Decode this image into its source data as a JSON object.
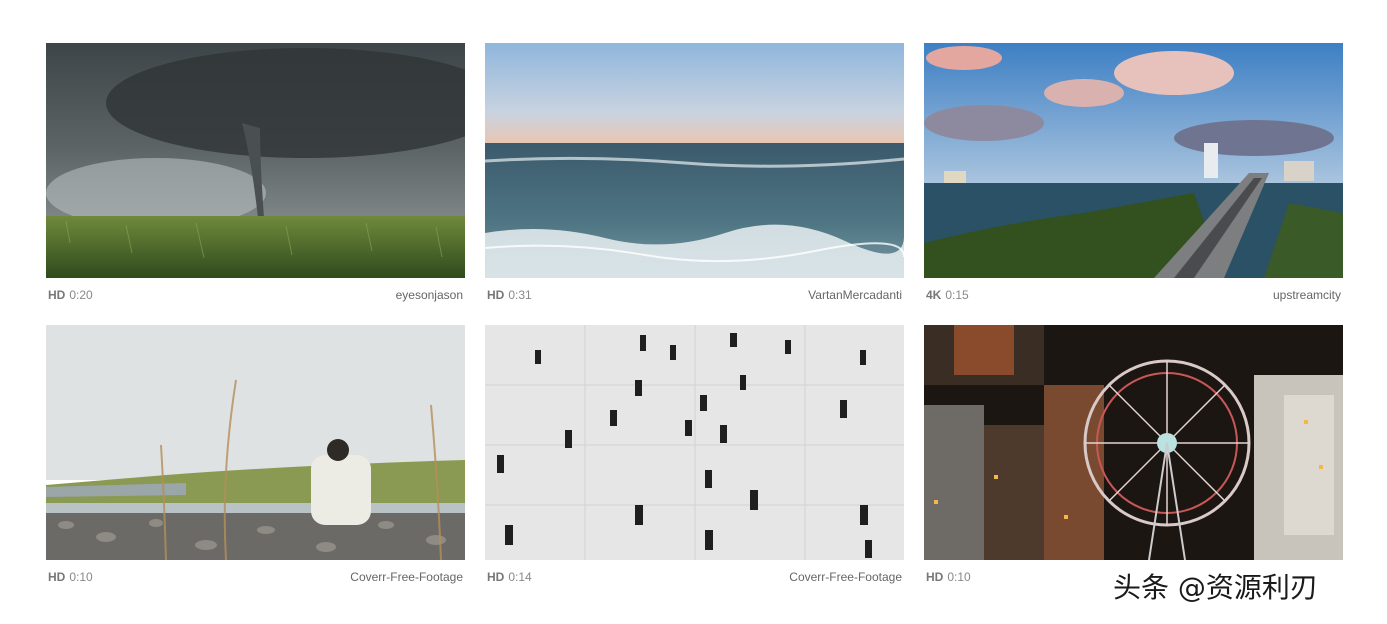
{
  "videos": [
    {
      "quality": "HD",
      "duration": "0:20",
      "author": "eyesonjason",
      "icon": "tornado-field-thumbnail"
    },
    {
      "quality": "HD",
      "duration": "0:31",
      "author": "VartanMercadanti",
      "icon": "ocean-waves-thumbnail"
    },
    {
      "quality": "4K",
      "duration": "0:15",
      "author": "upstreamcity",
      "icon": "city-highway-thumbnail"
    },
    {
      "quality": "HD",
      "duration": "0:10",
      "author": "Coverr-Free-Footage",
      "icon": "river-stones-thumbnail"
    },
    {
      "quality": "HD",
      "duration": "0:14",
      "author": "Coverr-Free-Footage",
      "icon": "crowd-plaza-thumbnail"
    },
    {
      "quality": "HD",
      "duration": "0:10",
      "author": "",
      "icon": "ferris-wheel-thumbnail"
    }
  ],
  "watermark": {
    "text": "头条 @资源利刃"
  }
}
